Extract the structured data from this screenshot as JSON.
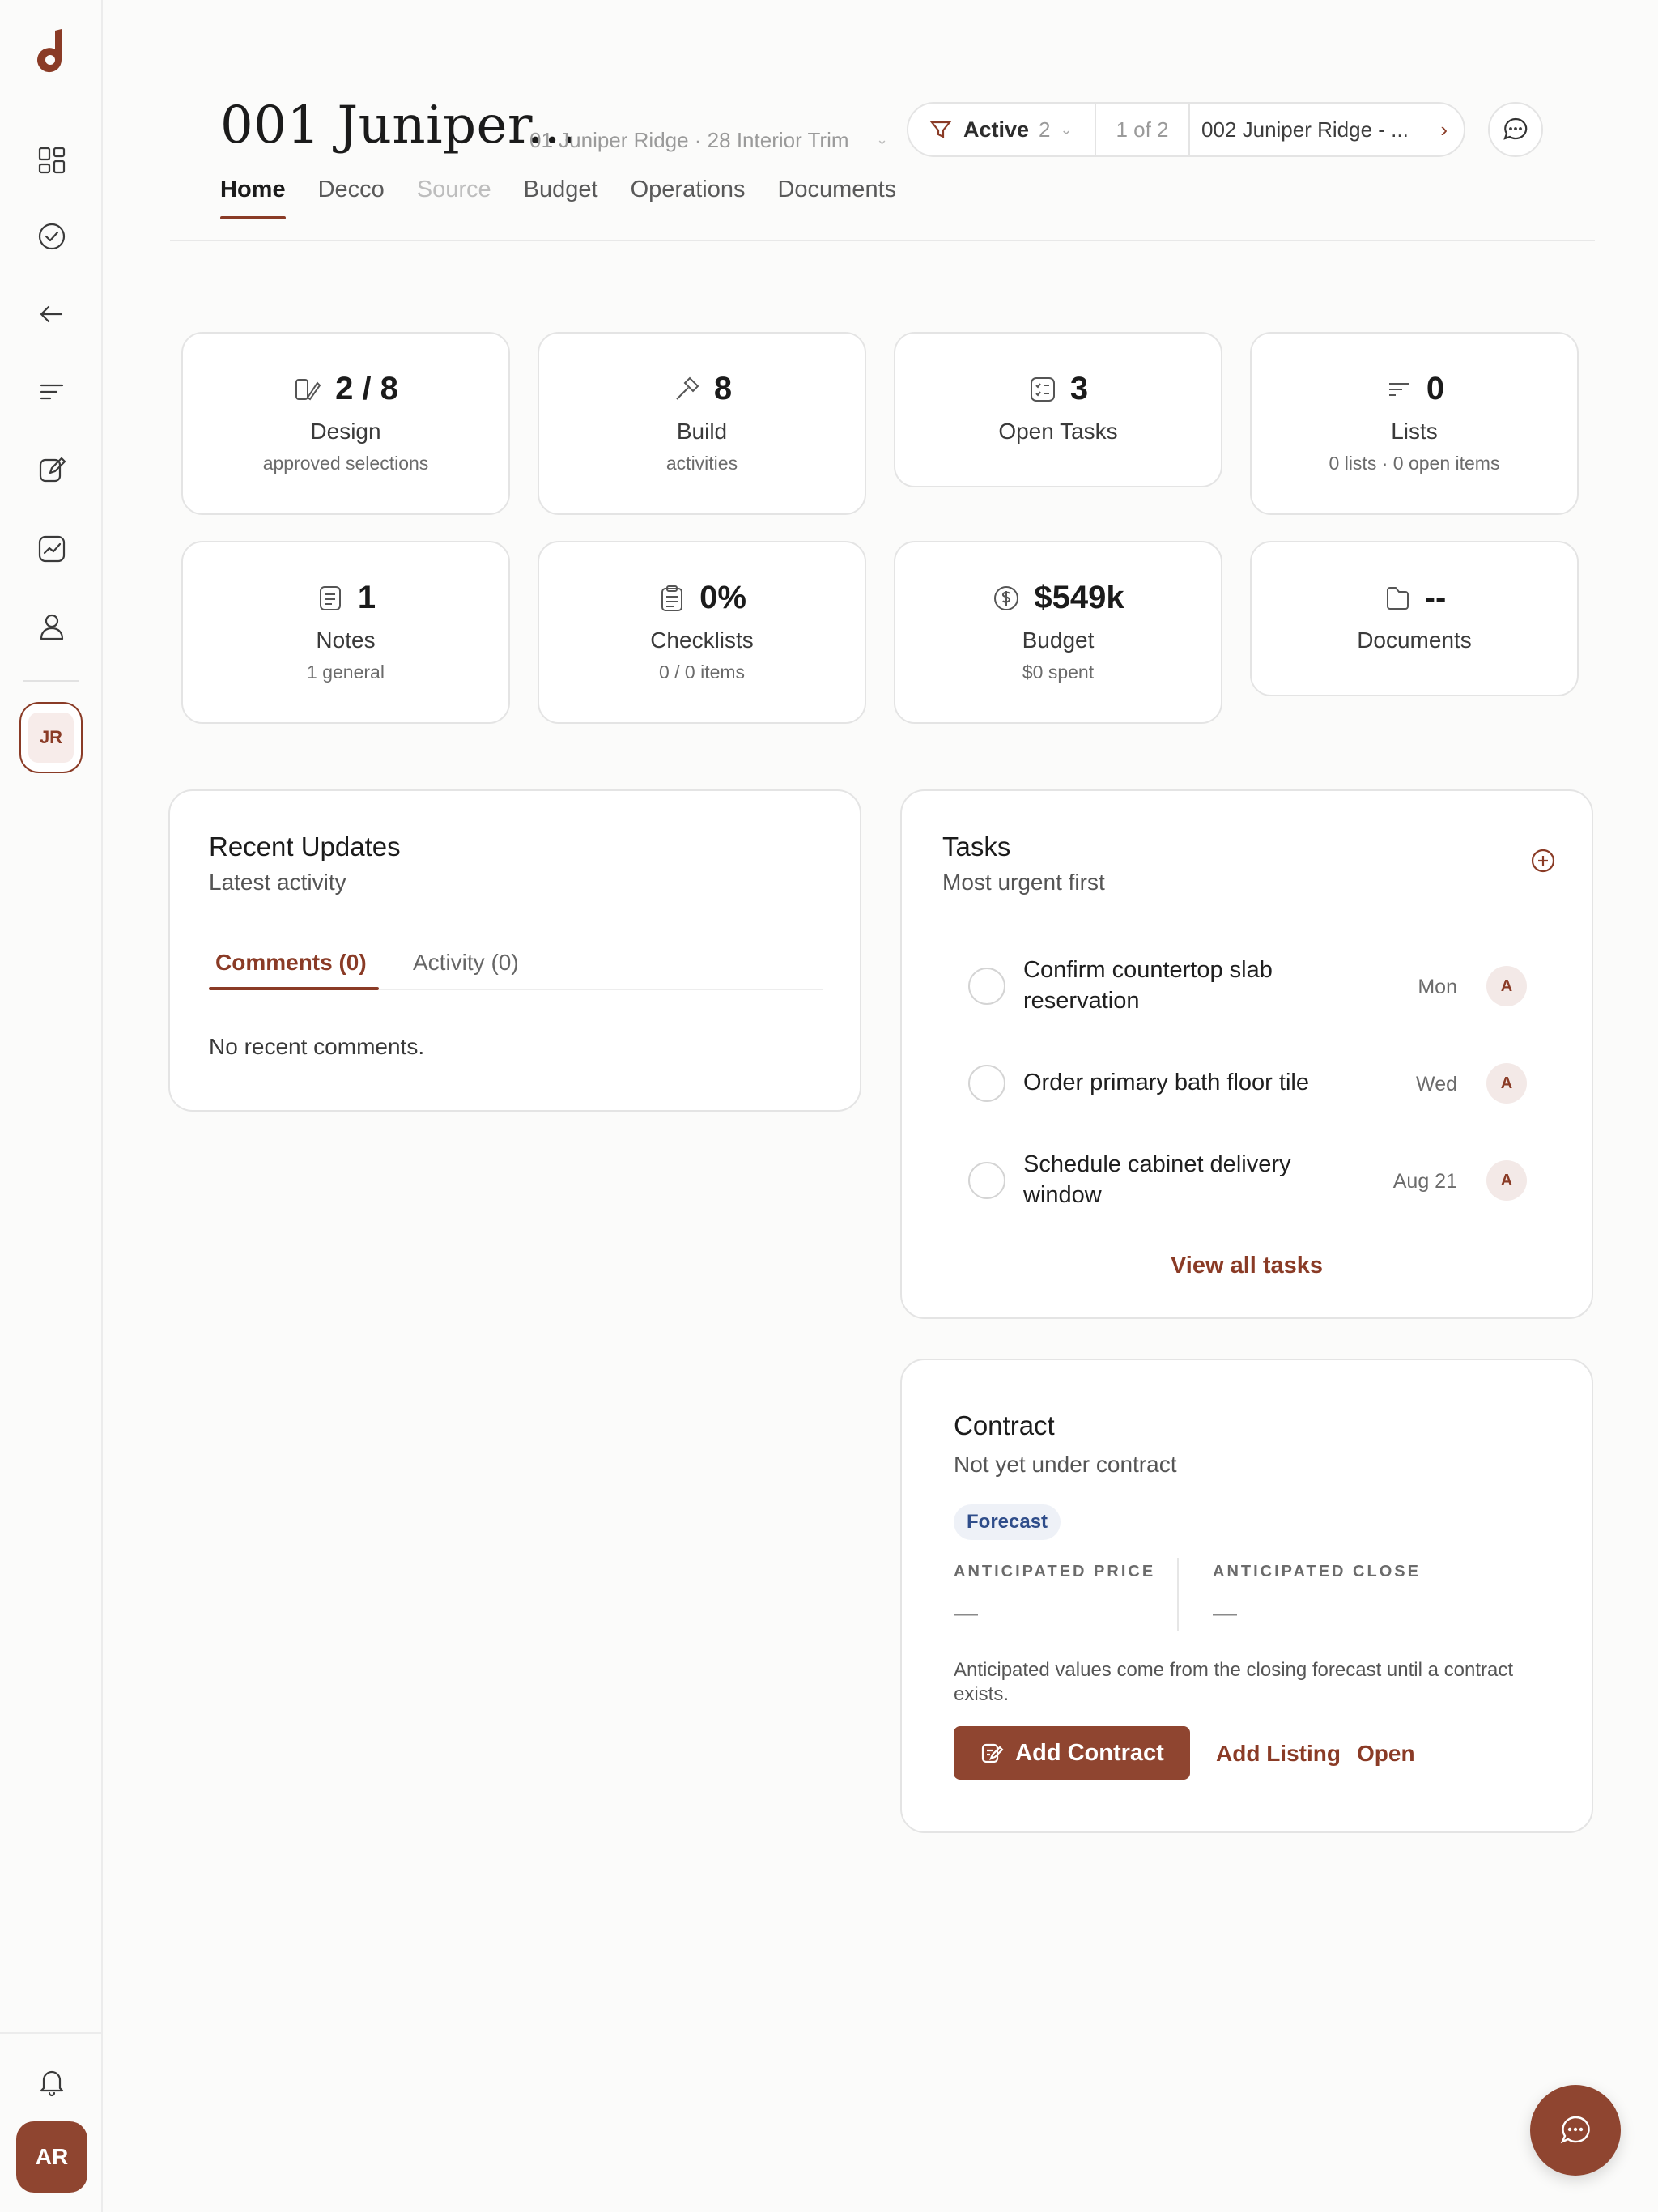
{
  "sidebar": {
    "icons": [
      "dashboard-icon",
      "check-circle-icon",
      "arrow-left-icon",
      "filter-lines-icon",
      "edit-icon",
      "chart-icon",
      "user-icon"
    ],
    "project_badge": "JR",
    "user_initials": "AR"
  },
  "header": {
    "title": "001 Juniper...",
    "subtitle": "01 Juniper Ridge · 28 Interior Trim",
    "status_label": "Active",
    "status_count": "2",
    "position": "1 of 2",
    "next_project": "002 Juniper Ridge - ..."
  },
  "tabs": [
    {
      "label": "Home",
      "state": "active"
    },
    {
      "label": "Decco",
      "state": "normal"
    },
    {
      "label": "Source",
      "state": "disabled"
    },
    {
      "label": "Budget",
      "state": "normal"
    },
    {
      "label": "Operations",
      "state": "normal"
    },
    {
      "label": "Documents",
      "state": "normal"
    }
  ],
  "stats": [
    {
      "value": "2 / 8",
      "name": "Design",
      "desc": "approved selections",
      "icon": "design-icon"
    },
    {
      "value": "8",
      "name": "Build",
      "desc": "activities",
      "icon": "hammer-icon"
    },
    {
      "value": "3",
      "name": "Open Tasks",
      "desc": "",
      "icon": "task-list-icon"
    },
    {
      "value": "0",
      "name": "Lists",
      "desc": "0 lists · 0 open items",
      "icon": "list-icon"
    },
    {
      "value": "1",
      "name": "Notes",
      "desc": "1 general",
      "icon": "note-icon"
    },
    {
      "value": "0%",
      "name": "Checklists",
      "desc": "0 / 0 items",
      "icon": "clipboard-icon"
    },
    {
      "value": "$549k",
      "name": "Budget",
      "desc": "$0 spent",
      "icon": "dollar-icon"
    },
    {
      "value": "--",
      "name": "Documents",
      "desc": "",
      "icon": "folder-icon"
    }
  ],
  "recent_updates": {
    "title": "Recent Updates",
    "subtitle": "Latest activity",
    "tab_comments": "Comments (0)",
    "tab_activity": "Activity (0)",
    "empty": "No recent comments."
  },
  "tasks": {
    "title": "Tasks",
    "subtitle": "Most urgent first",
    "items": [
      {
        "title": "Confirm countertop slab reservation",
        "due": "Mon",
        "assignee": "A"
      },
      {
        "title": "Order primary bath floor tile",
        "due": "Wed",
        "assignee": "A"
      },
      {
        "title": "Schedule cabinet delivery window",
        "due": "Aug 21",
        "assignee": "A"
      }
    ],
    "view_all": "View all tasks"
  },
  "contract": {
    "title": "Contract",
    "subtitle": "Not yet under contract",
    "badge": "Forecast",
    "price_label": "ANTICIPATED PRICE",
    "price_value": "—",
    "close_label": "ANTICIPATED CLOSE",
    "close_value": "—",
    "note": "Anticipated values come from the closing forecast until a contract exists.",
    "add_contract": "Add Contract",
    "add_listing": "Add Listing",
    "open": "Open"
  },
  "colors": {
    "accent": "#8a3b26",
    "button": "#8f4530",
    "forecast_badge_bg": "#eef1f7",
    "forecast_badge_text": "#2f4d8a"
  }
}
